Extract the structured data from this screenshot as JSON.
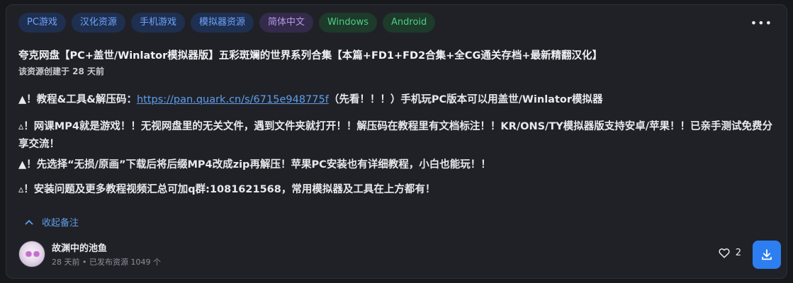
{
  "tags": [
    {
      "label": "PC游戏",
      "style": "blue"
    },
    {
      "label": "汉化资源",
      "style": "blue"
    },
    {
      "label": "手机游戏",
      "style": "blue"
    },
    {
      "label": "模拟器资源",
      "style": "blue"
    },
    {
      "label": "简体中文",
      "style": "purple"
    },
    {
      "label": "Windows",
      "style": "green"
    },
    {
      "label": "Android",
      "style": "green"
    }
  ],
  "more_label": "•••",
  "post": {
    "title": "夸克网盘【PC+盖世/Winlator模拟器版】五彩斑斓的世界系列合集【本篇+FD1+FD2合集+全CG通关存档+最新精翻汉化】",
    "created": "该资源创建于 28 天前",
    "line1_prefix": "▲！教程&工具&解压码：",
    "line1_link": "https://pan.quark.cn/s/6715e948775f",
    "line1_suffix": "（先看！！！）手机玩PC版本可以用盖世/Winlator模拟器",
    "line2": "▵！网课MP4就是游戏！！无视网盘里的无关文件，遇到文件夹就打开！！解压码在教程里有文档标注！！KR/ONS/TY模拟器版支持安卓/苹果！！已亲手测试免费分享交流！",
    "line3": "▲！先选择“无损/原画”下载后将后缀MP4改成zip再解压！苹果PC安装也有详细教程，小白也能玩！！",
    "line4": "▵！安装问题及更多教程视频汇总可加q群:1081621568，常用模拟器及工具在上方都有！"
  },
  "collapse_label": "收起备注",
  "user": {
    "name": "故渊中的池鱼",
    "meta": "28 天前 • 已发布资源 1049 个"
  },
  "likes": "2",
  "colors": {
    "accent": "#2d7ef0",
    "link": "#5e9eea",
    "background": "#202127"
  }
}
